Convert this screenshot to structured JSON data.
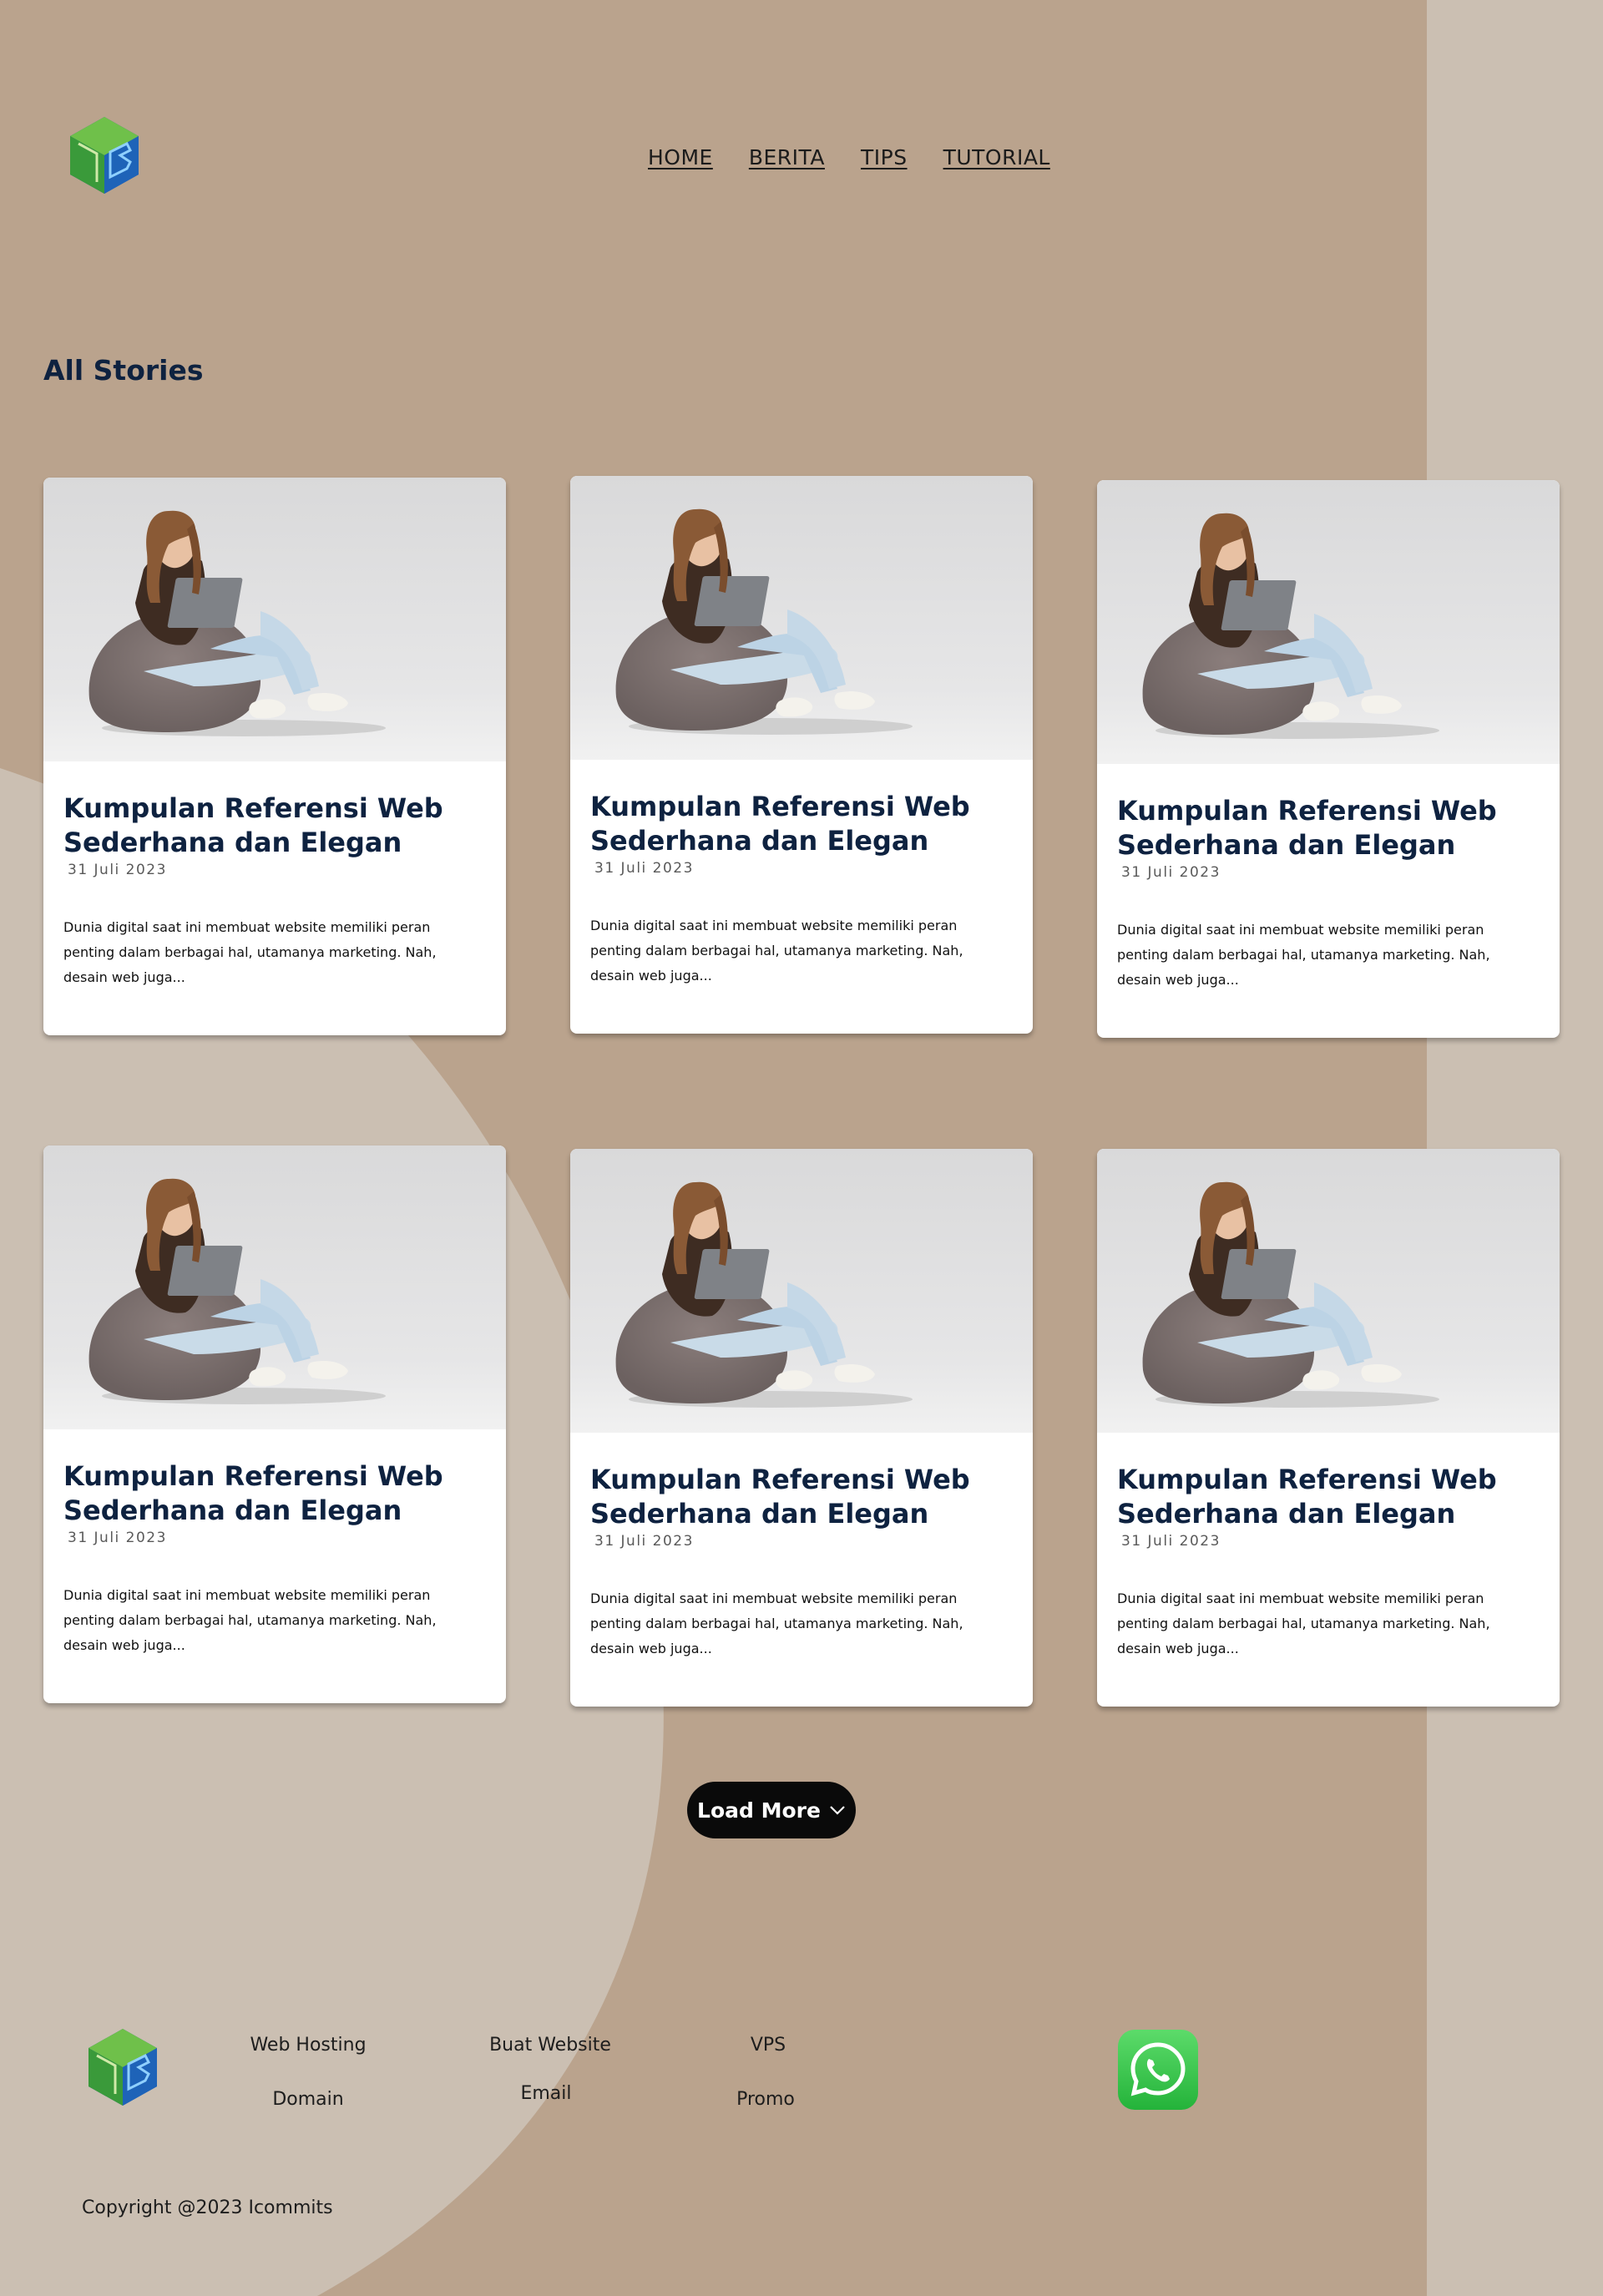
{
  "colors": {
    "background": "#baa38d",
    "background_light": "#cbbfb2",
    "title_navy": "#0e2240",
    "button": "#0a0a0a"
  },
  "header": {
    "logo_icon": "cube-logo-icon",
    "nav": [
      "HOME",
      "BERITA",
      "TIPS",
      "TUTORIAL"
    ]
  },
  "section": {
    "title": "All Stories"
  },
  "cards": [
    {
      "title": "Kumpulan Referensi Web Sederhana dan Elegan",
      "date": "31 Juli 2023",
      "excerpt": "Dunia digital saat ini membuat website memiliki peran penting dalam berbagai hal, utamanya marketing. Nah, desain web juga...",
      "image": "woman-laptop-beanbag-photo"
    },
    {
      "title": "Kumpulan Referensi Web Sederhana dan Elegan",
      "date": "31 Juli 2023",
      "excerpt": "Dunia digital saat ini membuat website memiliki peran penting dalam berbagai hal, utamanya marketing. Nah, desain web juga...",
      "image": "woman-laptop-beanbag-photo"
    },
    {
      "title": "Kumpulan Referensi Web Sederhana dan Elegan",
      "date": "31 Juli 2023",
      "excerpt": "Dunia digital saat ini membuat website memiliki peran penting dalam berbagai hal, utamanya marketing. Nah, desain web juga...",
      "image": "woman-laptop-beanbag-photo"
    },
    {
      "title": "Kumpulan Referensi Web Sederhana dan Elegan",
      "date": "31 Juli 2023",
      "excerpt": "Dunia digital saat ini membuat website memiliki peran penting dalam berbagai hal, utamanya marketing. Nah, desain web juga...",
      "image": "woman-laptop-beanbag-photo"
    },
    {
      "title": "Kumpulan Referensi Web Sederhana dan Elegan",
      "date": "31 Juli 2023",
      "excerpt": "Dunia digital saat ini membuat website memiliki peran penting dalam berbagai hal, utamanya marketing. Nah, desain web juga...",
      "image": "woman-laptop-beanbag-photo"
    },
    {
      "title": "Kumpulan Referensi Web Sederhana dan Elegan",
      "date": "31 Juli 2023",
      "excerpt": "Dunia digital saat ini membuat website memiliki peran penting dalam berbagai hal, utamanya marketing. Nah, desain web juga...",
      "image": "woman-laptop-beanbag-photo"
    }
  ],
  "load_more": {
    "label": "Load More",
    "icon": "chevron-down-icon"
  },
  "footer": {
    "links": {
      "web_hosting": "Web Hosting",
      "buat_website": "Buat Website",
      "vps": "VPS",
      "domain": "Domain",
      "email": "Email",
      "promo": "Promo"
    },
    "social_icon": "whatsapp-icon",
    "copyright": "Copyright @2023 Icommits"
  }
}
